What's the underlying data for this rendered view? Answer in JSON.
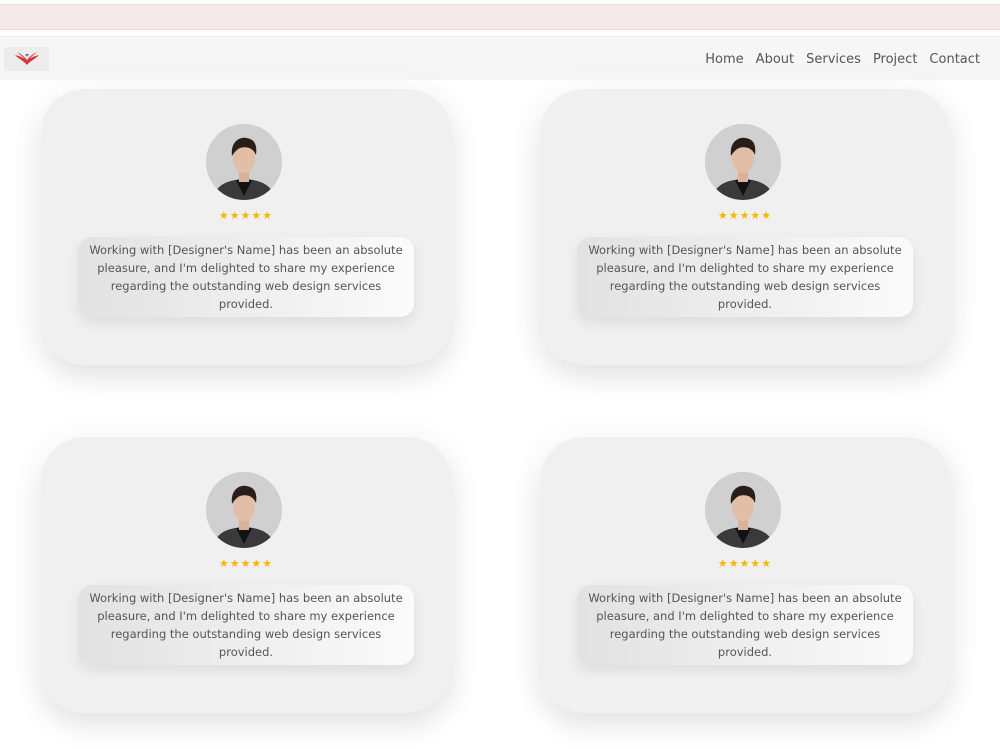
{
  "nav": {
    "logo_icon": "wings-logo-icon",
    "links": [
      "Home",
      "About",
      "Services",
      "Project",
      "Contact"
    ]
  },
  "testimonials": [
    {
      "avatar_icon": "person-avatar-icon",
      "stars": "★★★★★",
      "rating": 5,
      "text": "Working with [Designer's Name] has been an absolute pleasure, and I'm delighted to share my experience regarding the outstanding web design services provided."
    },
    {
      "avatar_icon": "person-avatar-icon",
      "stars": "★★★★★",
      "rating": 5,
      "text": "Working with [Designer's Name] has been an absolute pleasure, and I'm delighted to share my experience regarding the outstanding web design services provided."
    },
    {
      "avatar_icon": "person-avatar-icon",
      "stars": "★★★★★",
      "rating": 5,
      "text": "Working with [Designer's Name] has been an absolute pleasure, and I'm delighted to share my experience regarding the outstanding web design services provided."
    },
    {
      "avatar_icon": "person-avatar-icon",
      "stars": "★★★★★",
      "rating": 5,
      "text": "Working with [Designer's Name] has been an absolute pleasure, and I'm delighted to share my experience regarding the outstanding web design services provided."
    }
  ],
  "colors": {
    "star": "#f5b700",
    "logo_red": "#d9343a",
    "card_bg": "#f0f0f0",
    "top_band": "#f4e8e8"
  }
}
